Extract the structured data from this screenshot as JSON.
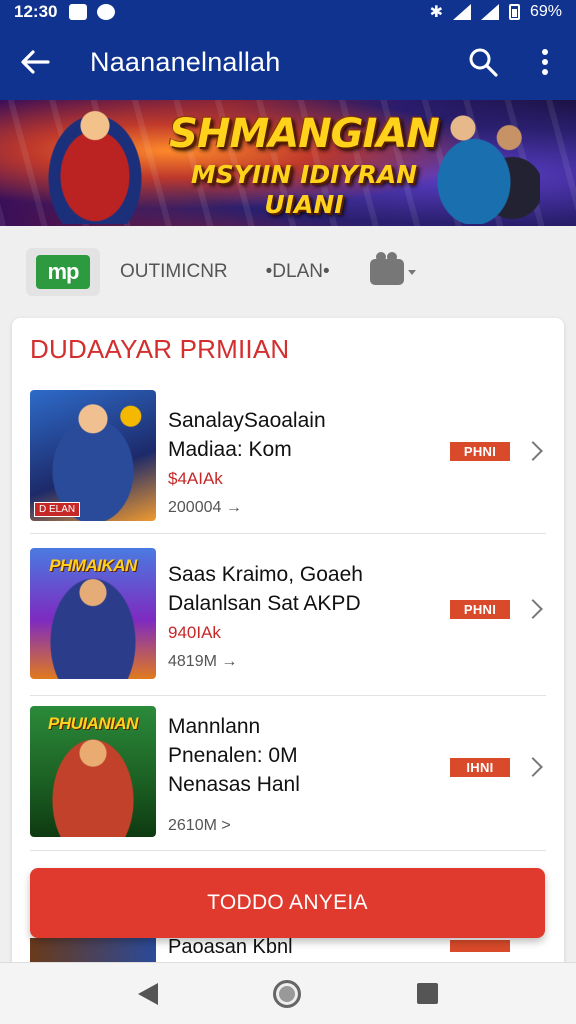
{
  "status_bar": {
    "time": "12:30",
    "battery_text": "69%",
    "icons": [
      "notification-icon",
      "notification-circle-icon",
      "bluetooth-icon",
      "wifi-icon",
      "signal-icon",
      "battery-icon"
    ]
  },
  "app_bar": {
    "title": "Naananelnallah",
    "icons": [
      "arrow-left-icon",
      "search-icon",
      "more-vert-icon"
    ]
  },
  "banner": {
    "title": "SHMANGIAN",
    "subtitle": "MSYIIN IDIYRAN UIANI"
  },
  "tabs": {
    "logo_text": "mp",
    "items": [
      {
        "label": "OUTIMICNR"
      },
      {
        "label": "•DLAN•"
      }
    ],
    "camera_icon": "camera-icon"
  },
  "section": {
    "heading": "DUDAAYAR PRMIIAN"
  },
  "items": [
    {
      "thumb_label": "",
      "thumb_badge": "D ELAN",
      "line1": "SanalaySaoalain",
      "line2": "Madiaa: Kom",
      "price": "$4AIAk",
      "meta": "200004 →",
      "tag": "PHNI"
    },
    {
      "thumb_label": "PHMAIKAN",
      "thumb_badge": "",
      "line1": "Saas Kraimo, Goaeh",
      "line2": "Dalanlsan Sat AKPD",
      "price": "940IAk",
      "meta": "4819M →",
      "tag": "PHNI"
    },
    {
      "thumb_label": "PHUIANIAN",
      "thumb_badge": "",
      "line1": "Mannlann",
      "line2": "Pnenalen: 0M",
      "line3": "Nenasas Hanl",
      "meta": "2610M >",
      "tag": "IHNI"
    }
  ],
  "cta": {
    "label": "TODDO ANYEIA"
  },
  "peek_item": {
    "text": "Paoasan Kbnl"
  },
  "colors": {
    "header": "#10338f",
    "accent_red": "#e03a2e",
    "heading_red": "#d32f2f",
    "tag_red": "#d94a2a",
    "logo_green": "#2e9a3f"
  }
}
